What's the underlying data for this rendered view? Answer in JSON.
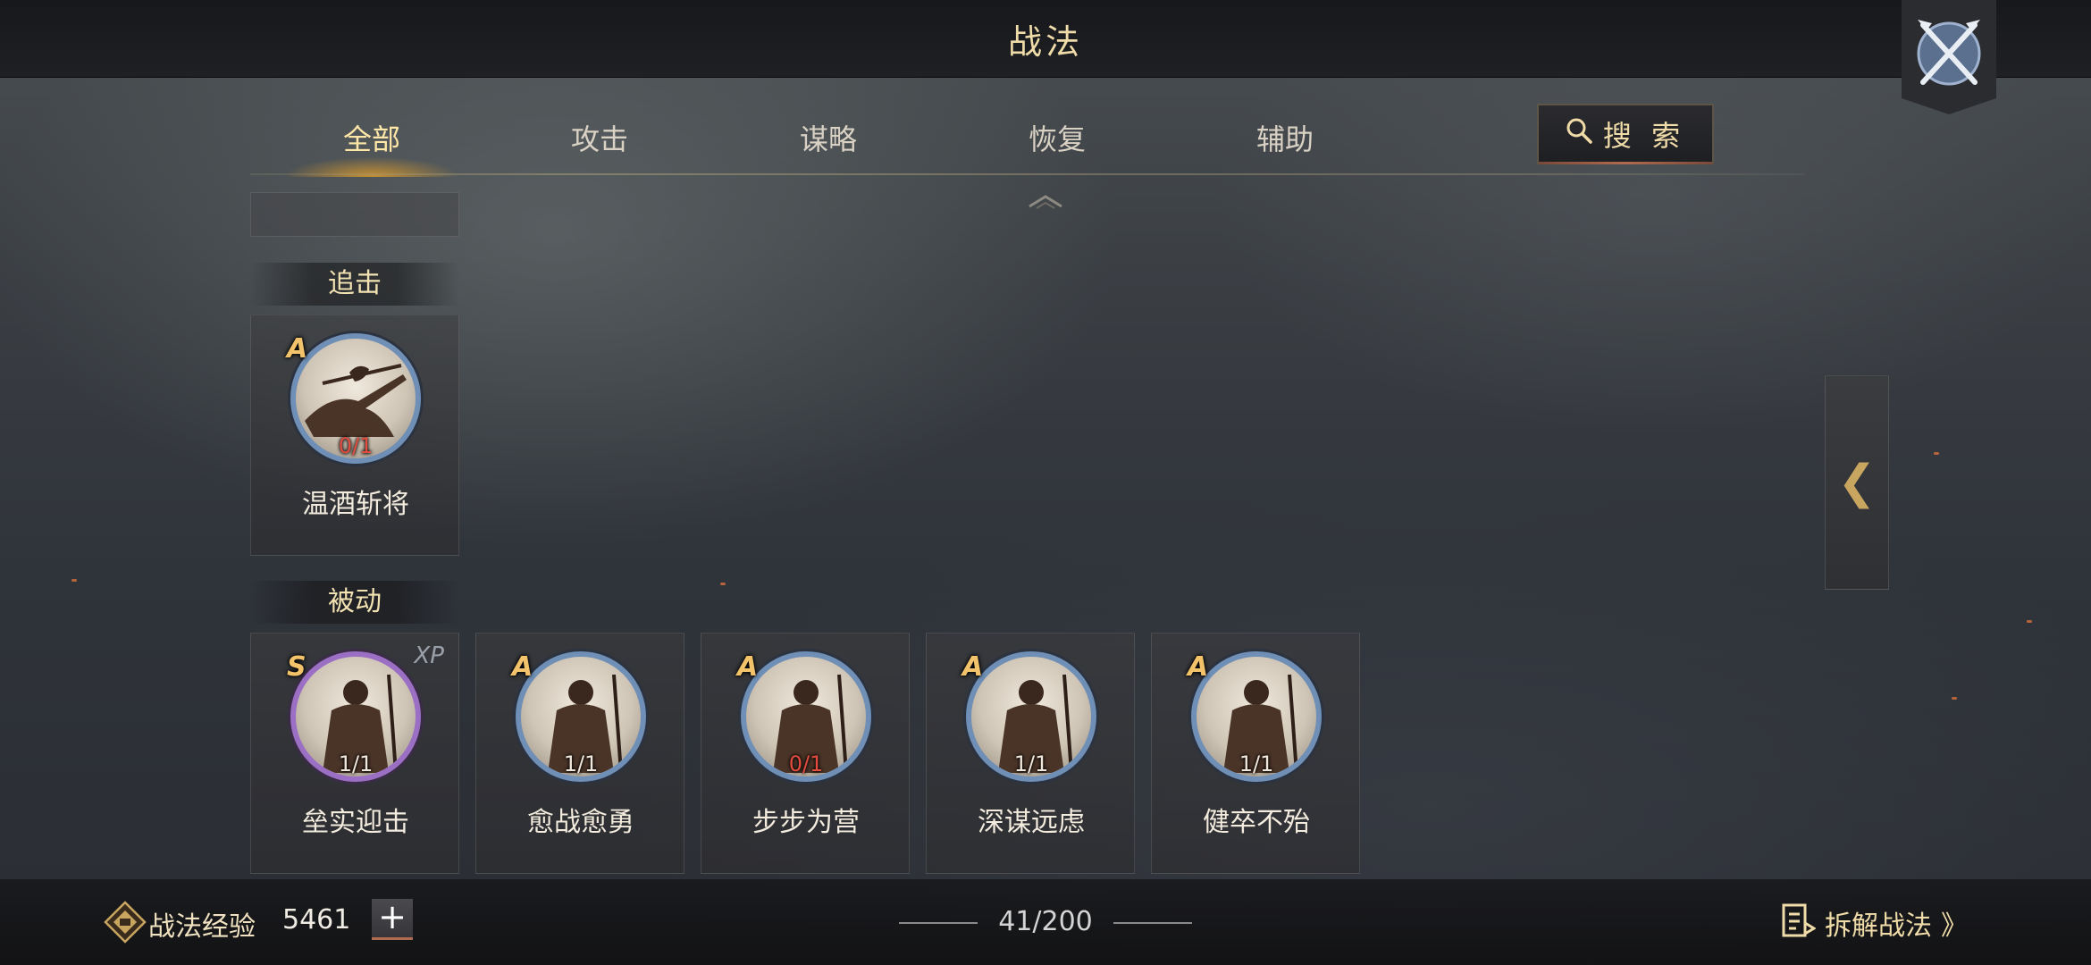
{
  "header": {
    "title": "战法"
  },
  "tabs": [
    "全部",
    "攻击",
    "谋略",
    "恢复",
    "辅助"
  ],
  "search": {
    "label": "搜 索"
  },
  "sections": [
    {
      "label": "追击",
      "skills": [
        {
          "grade": "A",
          "name": "温酒斩将",
          "count": "0/1"
        }
      ]
    },
    {
      "label": "被动",
      "skills": [
        {
          "grade": "S",
          "name": "垒实迎击",
          "count": "1/1",
          "tag": "XP"
        },
        {
          "grade": "A",
          "name": "愈战愈勇",
          "count": "1/1"
        },
        {
          "grade": "A",
          "name": "步步为营",
          "count": "0/1"
        },
        {
          "grade": "A",
          "name": "深谋远虑",
          "count": "1/1"
        },
        {
          "grade": "A",
          "name": "健卒不殆",
          "count": "1/1"
        }
      ]
    }
  ],
  "side_handle": {
    "glyph": "❮"
  },
  "footer": {
    "exp_label": "战法经验",
    "exp_value": "5461",
    "plus": "+",
    "capacity": "41/200",
    "dismantle_label": "拆解战法",
    "dismantle_chevron": "》"
  },
  "colors": {
    "accent_gold": "#f0dca8",
    "grade_a": "#6f8fb6",
    "grade_s": "#9b6fc4",
    "count_zero": "#e34c3e"
  },
  "icons": [
    "crossed-swords-icon",
    "search-icon",
    "chevron-up-icon",
    "chevron-left-icon",
    "skill-exp-icon",
    "dismantle-icon",
    "double-chevron-right-icon"
  ]
}
